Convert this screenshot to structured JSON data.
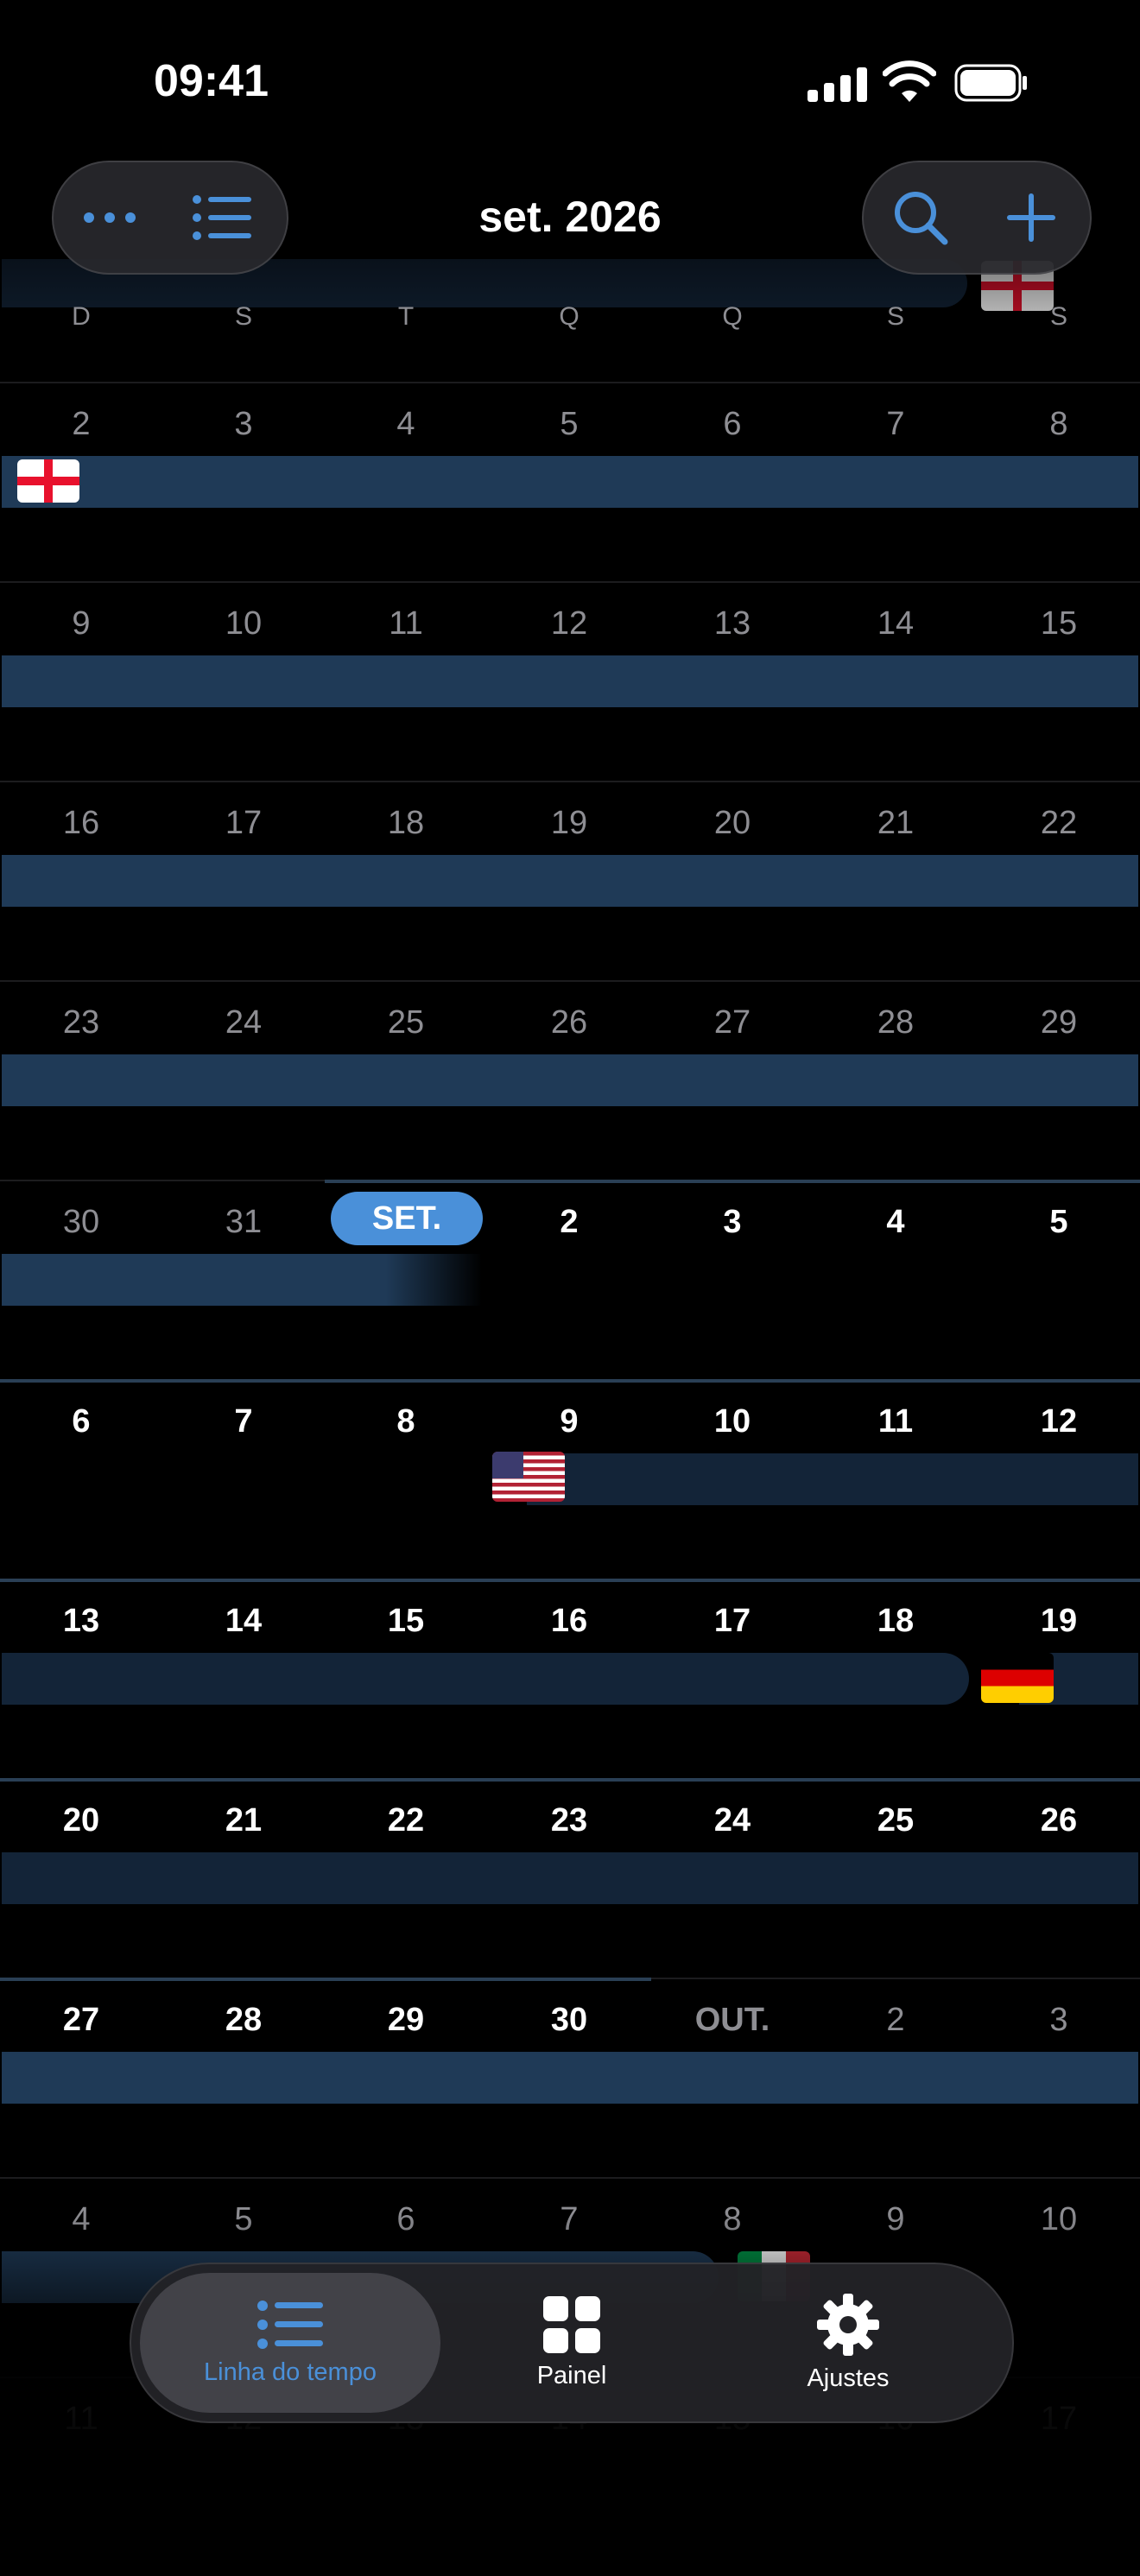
{
  "status": {
    "time": "09:41"
  },
  "header": {
    "month_title": "set. 2026"
  },
  "weekdays": [
    "D",
    "S",
    "T",
    "Q",
    "Q",
    "S",
    "S"
  ],
  "weeks": [
    {
      "days": [
        "2",
        "3",
        "4",
        "5",
        "6",
        "7",
        "8"
      ]
    },
    {
      "days": [
        "9",
        "10",
        "11",
        "12",
        "13",
        "14",
        "15"
      ]
    },
    {
      "days": [
        "16",
        "17",
        "18",
        "19",
        "20",
        "21",
        "22"
      ]
    },
    {
      "days": [
        "23",
        "24",
        "25",
        "26",
        "27",
        "28",
        "29"
      ]
    },
    {
      "days": [
        "30",
        "31",
        "SET.",
        "2",
        "3",
        "4",
        "5"
      ]
    },
    {
      "days": [
        "6",
        "7",
        "8",
        "9",
        "10",
        "11",
        "12"
      ]
    },
    {
      "days": [
        "13",
        "14",
        "15",
        "16",
        "17",
        "18",
        "19"
      ]
    },
    {
      "days": [
        "20",
        "21",
        "22",
        "23",
        "24",
        "25",
        "26"
      ]
    },
    {
      "days": [
        "27",
        "28",
        "29",
        "30",
        "OUT.",
        "2",
        "3"
      ]
    },
    {
      "days": [
        "4",
        "5",
        "6",
        "7",
        "8",
        "9",
        "10"
      ]
    },
    {
      "days": [
        "11",
        "12",
        "13",
        "14",
        "15",
        "16",
        "17"
      ]
    }
  ],
  "tabs": [
    {
      "label": "Linha do tempo",
      "icon": "list-icon",
      "active": true
    },
    {
      "label": "Painel",
      "icon": "grid-icon",
      "active": false
    },
    {
      "label": "Ajustes",
      "icon": "gear-icon",
      "active": false
    }
  ],
  "colors": {
    "accent": "#4a90d9",
    "trip_bar": "#1f3a57",
    "background": "#000000"
  }
}
